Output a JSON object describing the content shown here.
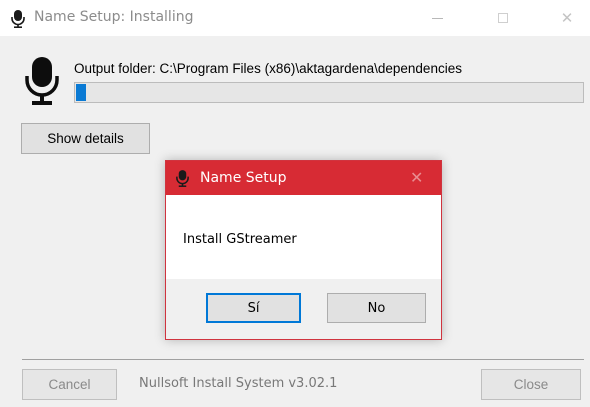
{
  "window": {
    "title": "Name Setup: Installing",
    "minimize_icon": "minimize-icon",
    "maximize_icon": "maximize-icon",
    "close_icon": "close-icon"
  },
  "main": {
    "app_icon": "microphone-icon",
    "output_folder_text": "Output folder: C:\\Program Files (x86)\\aktagardena\\dependencies",
    "progress_fraction": 0.02,
    "progress_color": "#0a7ad4",
    "show_details_label": "Show details"
  },
  "footer": {
    "cancel_label": "Cancel",
    "brand_text": "Nullsoft Install System v3.02.1",
    "close_label": "Close"
  },
  "dialog": {
    "title": "Name Setup",
    "title_bar_color": "#d72b34",
    "message": "Install GStreamer",
    "yes_label": "Sí",
    "no_label": "No",
    "close_glyph": "✕"
  }
}
